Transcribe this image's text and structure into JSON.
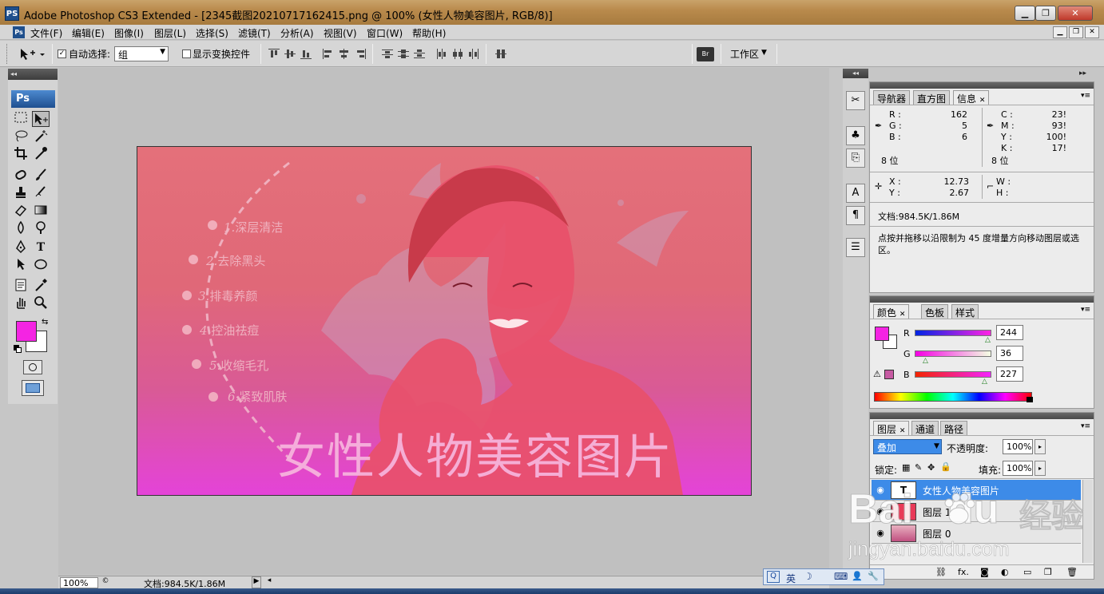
{
  "window": {
    "title": "Adobe Photoshop CS3 Extended - [2345截图20210717162415.png @ 100% (女性人物美容图片, RGB/8)]",
    "app_icon": "PS",
    "minimize": "▁",
    "restore": "❐",
    "close": "✕"
  },
  "menubar": {
    "icon": "Ps",
    "items": [
      "文件(F)",
      "编辑(E)",
      "图像(I)",
      "图层(L)",
      "选择(S)",
      "滤镜(T)",
      "分析(A)",
      "视图(V)",
      "窗口(W)",
      "帮助(H)"
    ],
    "doc_min": "▁",
    "doc_restore": "❐",
    "doc_close": "✕"
  },
  "options": {
    "move_tool_icon": "move-tool",
    "auto_select_label": "自动选择:",
    "auto_select_checked": "✓",
    "auto_select_value": "组",
    "show_transform_label": "显示变换控件",
    "workspace_label": "工作区",
    "workspace_arrow": "▼",
    "select_arrow": "▼"
  },
  "toolbox": {
    "collapse": "◂◂",
    "logo": "Ps",
    "fg_color": "#f424e3",
    "bg_color": "#ffffff"
  },
  "canvas": {
    "steps": [
      {
        "num": "1.",
        "text": "深层清洁"
      },
      {
        "num": "2.",
        "text": "去除黑头"
      },
      {
        "num": "3.",
        "text": "排毒养颜"
      },
      {
        "num": "4.",
        "text": "控油祛痘"
      },
      {
        "num": "5.",
        "text": "收缩毛孔"
      },
      {
        "num": "6.",
        "text": "紧致肌肤"
      }
    ],
    "headline": "女性人物美容图片"
  },
  "statusbar": {
    "zoom": "100%",
    "doc_info": "文档:984.5K/1.86M",
    "arrow": "▶",
    "left_arrow": "◂"
  },
  "panel_info": {
    "collapse": "▸▸",
    "tabs": [
      "导航器",
      "直方图",
      "信息"
    ],
    "close": "✕",
    "rgb": {
      "R": "162",
      "G": "5",
      "B": "6"
    },
    "cmyk": {
      "C": "23!",
      "M": "93!",
      "Y": "100!",
      "K": "17!"
    },
    "bits_left": "8 位",
    "bits_right": "8 位",
    "xy": {
      "X": "12.73",
      "Y": "2.67"
    },
    "wh": {
      "W": "",
      "H": ""
    },
    "doc": "文档:984.5K/1.86M",
    "hint": "点按并拖移以沿限制为 45 度增量方向移动图层或选区。",
    "labels": {
      "R": "R :",
      "G": "G :",
      "B": "B :",
      "C": "C :",
      "M": "M :",
      "Y": "Y :",
      "K": "K :",
      "X": "X :",
      "Yc": "Y :",
      "W": "W :",
      "H": "H :"
    }
  },
  "panel_color": {
    "tabs": [
      "颜色",
      "色板",
      "样式"
    ],
    "close": "✕",
    "R": "244",
    "G": "36",
    "B": "227",
    "labels": {
      "R": "R",
      "G": "G",
      "B": "B"
    },
    "swatch": "#f424e3",
    "warn_swatch": "#c75ba3"
  },
  "panel_layers": {
    "tabs": [
      "图层",
      "通道",
      "路径"
    ],
    "close": "✕",
    "blend_mode": "叠加",
    "opacity_label": "不透明度:",
    "opacity": "100%",
    "lock_label": "锁定:",
    "fill_label": "填充:",
    "fill": "100%",
    "layers": [
      {
        "name": "女性人物美容图片",
        "thumb": "T",
        "selected": true
      },
      {
        "name": "图层 1",
        "thumb": "",
        "selected": false
      },
      {
        "name": "图层 0",
        "thumb": "",
        "selected": false
      }
    ],
    "footer": [
      "⛓",
      "fx.",
      "◙",
      "◐",
      "▭",
      "❐",
      "🗑"
    ],
    "eye": "👁"
  },
  "ime": {
    "items": [
      "英",
      "☽",
      "⌨",
      "👤",
      "🔧"
    ]
  },
  "watermark": {
    "brand": "Bai",
    "brand2": "du",
    "brand_cn": "经验",
    "url": "jingyan.baidu.com"
  }
}
